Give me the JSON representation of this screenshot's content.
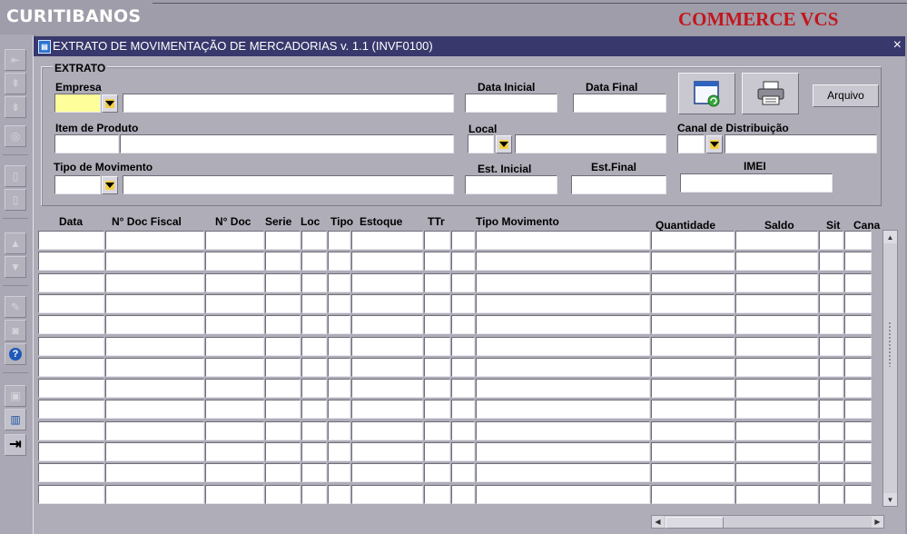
{
  "app": {
    "title": "CURITIBANOS",
    "brand": "COMMERCE VCS"
  },
  "window": {
    "title": "EXTRATO DE MOVIMENTAÇÃO DE MERCADORIAS v. 1.1 (INVF0100)",
    "close_glyph": "×"
  },
  "filters": {
    "group_title": "EXTRATO",
    "empresa": {
      "label": "Empresa",
      "code": "",
      "name": ""
    },
    "data_inicial": {
      "label": "Data Inicial",
      "value": ""
    },
    "data_final": {
      "label": "Data Final",
      "value": ""
    },
    "item_produto": {
      "label": "Item de Produto",
      "code": "",
      "name": ""
    },
    "local": {
      "label": "Local",
      "code": "",
      "name": ""
    },
    "canal": {
      "label": "Canal de Distribuição",
      "code": "",
      "name": ""
    },
    "tipo_movimento": {
      "label": "Tipo de Movimento",
      "code": "",
      "name": ""
    },
    "est_inicial": {
      "label": "Est. Inicial",
      "value": ""
    },
    "est_final": {
      "label": "Est.Final",
      "value": ""
    },
    "imei": {
      "label": "IMEI",
      "value": ""
    },
    "arquivo_label": "Arquivo"
  },
  "table": {
    "headers": [
      "Data",
      "N° Doc Fiscal",
      "N° Doc",
      "Serie",
      "Loc",
      "Tipo",
      "Estoque",
      "TTr",
      "Tipo Movimento",
      "Quantidade",
      "Saldo",
      "Sit",
      "Cana"
    ],
    "rows": [
      [],
      [],
      [],
      [],
      [],
      [],
      [],
      [],
      [],
      [],
      [],
      [],
      []
    ]
  },
  "icons": {
    "toolbar": [
      "save-icon",
      "exit-icon",
      "help-icon",
      "trash-icon"
    ],
    "refresh": "refresh-window-icon",
    "print": "printer-icon"
  },
  "colors": {
    "title_bar": "#38386c",
    "brand": "#c3161c",
    "required_field": "#feff9b"
  }
}
